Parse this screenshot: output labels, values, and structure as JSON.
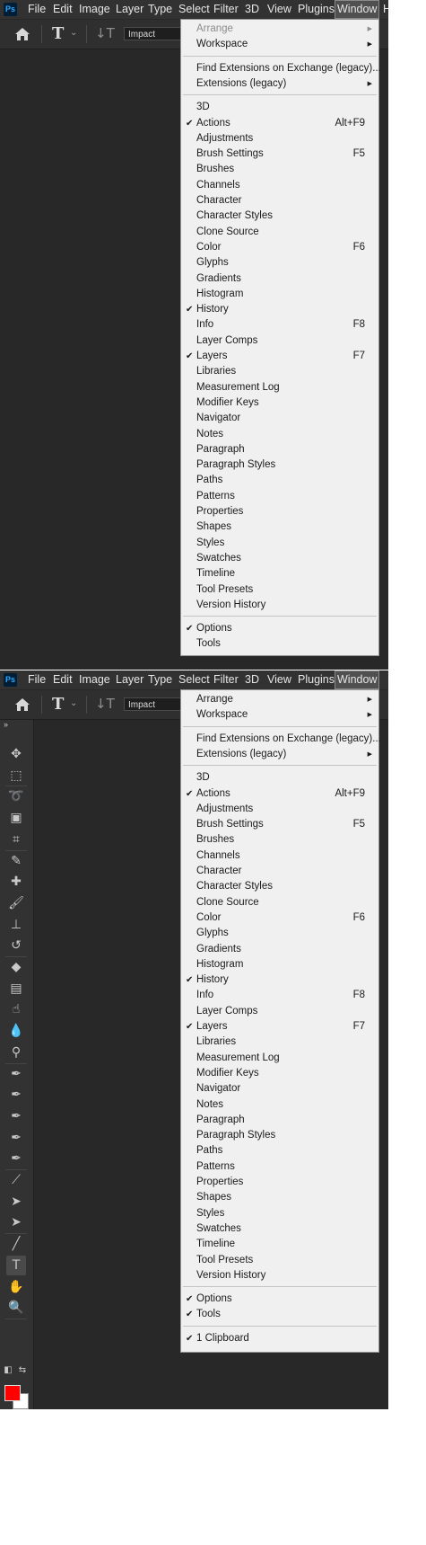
{
  "app": {
    "logo_text": "Ps",
    "menus": [
      "File",
      "Edit",
      "Image",
      "Layer",
      "Type",
      "Select",
      "Filter",
      "3D",
      "View",
      "Plugins",
      "Window"
    ],
    "active_menu": "Window",
    "clipped_menu_letter": "H"
  },
  "options_bar": {
    "font_family": "Impact"
  },
  "window_menu_1": {
    "groups": [
      [
        {
          "label": "Arrange",
          "submenu": true,
          "disabled": true
        },
        {
          "label": "Workspace",
          "submenu": true
        }
      ],
      [
        {
          "label": "Find Extensions on Exchange (legacy)..."
        },
        {
          "label": "Extensions (legacy)",
          "submenu": true
        }
      ],
      [
        {
          "label": "3D"
        },
        {
          "label": "Actions",
          "checked": true,
          "shortcut": "Alt+F9"
        },
        {
          "label": "Adjustments"
        },
        {
          "label": "Brush Settings",
          "shortcut": "F5"
        },
        {
          "label": "Brushes"
        },
        {
          "label": "Channels"
        },
        {
          "label": "Character"
        },
        {
          "label": "Character Styles"
        },
        {
          "label": "Clone Source"
        },
        {
          "label": "Color",
          "shortcut": "F6"
        },
        {
          "label": "Glyphs"
        },
        {
          "label": "Gradients"
        },
        {
          "label": "Histogram"
        },
        {
          "label": "History",
          "checked": true
        },
        {
          "label": "Info",
          "shortcut": "F8"
        },
        {
          "label": "Layer Comps"
        },
        {
          "label": "Layers",
          "checked": true,
          "shortcut": "F7"
        },
        {
          "label": "Libraries"
        },
        {
          "label": "Measurement Log"
        },
        {
          "label": "Modifier Keys"
        },
        {
          "label": "Navigator"
        },
        {
          "label": "Notes"
        },
        {
          "label": "Paragraph"
        },
        {
          "label": "Paragraph Styles"
        },
        {
          "label": "Paths"
        },
        {
          "label": "Patterns"
        },
        {
          "label": "Properties"
        },
        {
          "label": "Shapes"
        },
        {
          "label": "Styles"
        },
        {
          "label": "Swatches"
        },
        {
          "label": "Timeline"
        },
        {
          "label": "Tool Presets"
        },
        {
          "label": "Version History"
        }
      ],
      [
        {
          "label": "Options",
          "checked": true
        },
        {
          "label": "Tools"
        }
      ]
    ]
  },
  "window_menu_2": {
    "groups": [
      [
        {
          "label": "Arrange",
          "submenu": true
        },
        {
          "label": "Workspace",
          "submenu": true
        }
      ],
      [
        {
          "label": "Find Extensions on Exchange (legacy)..."
        },
        {
          "label": "Extensions (legacy)",
          "submenu": true
        }
      ],
      [
        {
          "label": "3D"
        },
        {
          "label": "Actions",
          "checked": true,
          "shortcut": "Alt+F9"
        },
        {
          "label": "Adjustments"
        },
        {
          "label": "Brush Settings",
          "shortcut": "F5"
        },
        {
          "label": "Brushes"
        },
        {
          "label": "Channels"
        },
        {
          "label": "Character"
        },
        {
          "label": "Character Styles"
        },
        {
          "label": "Clone Source"
        },
        {
          "label": "Color",
          "shortcut": "F6"
        },
        {
          "label": "Glyphs"
        },
        {
          "label": "Gradients"
        },
        {
          "label": "Histogram"
        },
        {
          "label": "History",
          "checked": true
        },
        {
          "label": "Info",
          "shortcut": "F8"
        },
        {
          "label": "Layer Comps"
        },
        {
          "label": "Layers",
          "checked": true,
          "shortcut": "F7"
        },
        {
          "label": "Libraries"
        },
        {
          "label": "Measurement Log"
        },
        {
          "label": "Modifier Keys"
        },
        {
          "label": "Navigator"
        },
        {
          "label": "Notes"
        },
        {
          "label": "Paragraph"
        },
        {
          "label": "Paragraph Styles"
        },
        {
          "label": "Paths"
        },
        {
          "label": "Patterns"
        },
        {
          "label": "Properties"
        },
        {
          "label": "Shapes"
        },
        {
          "label": "Styles"
        },
        {
          "label": "Swatches"
        },
        {
          "label": "Timeline"
        },
        {
          "label": "Tool Presets"
        },
        {
          "label": "Version History"
        }
      ],
      [
        {
          "label": "Options",
          "checked": true
        },
        {
          "label": "Tools",
          "checked": true
        }
      ],
      [
        {
          "label": "1 Clipboard",
          "checked": true
        }
      ]
    ]
  },
  "toolbar": {
    "tools": [
      {
        "name": "move-tool-icon",
        "glyph": "✥"
      },
      {
        "name": "rectangular-marquee-tool-icon",
        "glyph": "⬚"
      },
      {
        "name": "lasso-tool-icon",
        "glyph": "➰"
      },
      {
        "name": "object-selection-tool-icon",
        "glyph": "▣"
      },
      {
        "name": "crop-tool-icon",
        "glyph": "⌗"
      },
      {
        "name": "eyedropper-tool-icon",
        "glyph": "✎"
      },
      {
        "name": "healing-brush-tool-icon",
        "glyph": "✚"
      },
      {
        "name": "brush-tool-icon",
        "glyph": "🖌"
      },
      {
        "name": "clone-stamp-tool-icon",
        "glyph": "⊥"
      },
      {
        "name": "history-brush-tool-icon",
        "glyph": "↺"
      },
      {
        "name": "eraser-tool-icon",
        "glyph": "◆"
      },
      {
        "name": "gradient-tool-icon",
        "glyph": "▤"
      },
      {
        "name": "smudge-tool-icon",
        "glyph": "☝"
      },
      {
        "name": "blur-tool-icon",
        "glyph": "💧"
      },
      {
        "name": "dodge-tool-icon",
        "glyph": "⚲"
      },
      {
        "name": "pen-tool-icon",
        "glyph": "✒"
      },
      {
        "name": "freeform-pen-tool-icon",
        "glyph": "✒"
      },
      {
        "name": "add-anchor-point-tool-icon",
        "glyph": "✒"
      },
      {
        "name": "delete-anchor-point-tool-icon",
        "glyph": "✒"
      },
      {
        "name": "curvature-pen-tool-icon",
        "glyph": "✒"
      },
      {
        "name": "convert-point-tool-icon",
        "glyph": "⟋"
      },
      {
        "name": "path-selection-tool-icon",
        "glyph": "➤"
      },
      {
        "name": "direct-selection-tool-icon",
        "glyph": "➤"
      },
      {
        "name": "line-tool-icon",
        "glyph": "╱"
      },
      {
        "name": "type-tool-icon",
        "glyph": "T",
        "active": true
      },
      {
        "name": "hand-tool-icon",
        "glyph": "✋"
      },
      {
        "name": "zoom-tool-icon",
        "glyph": "🔍"
      }
    ],
    "colors": {
      "foreground": "#ff0000",
      "background": "#ffffff"
    }
  }
}
